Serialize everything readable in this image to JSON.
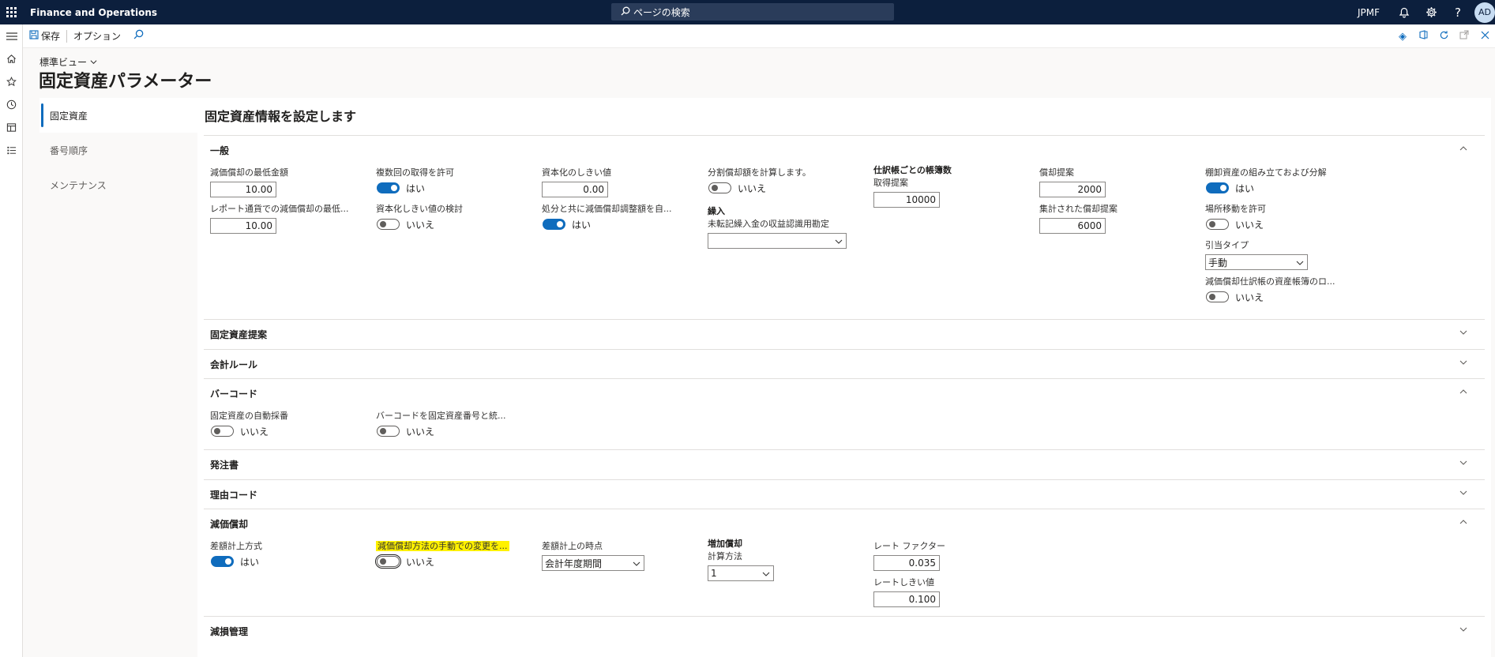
{
  "topbar": {
    "app_title": "Finance and Operations",
    "search_placeholder": "ページの検索",
    "company": "JPMF",
    "avatar_initials": "AD",
    "icons": [
      "waffle-icon",
      "bell-icon",
      "gear-icon",
      "help-icon"
    ]
  },
  "actionpane": {
    "save_label": "保存",
    "options_label": "オプション"
  },
  "header": {
    "view_selector": "標準ビュー",
    "page_title": "固定資産パラメーター"
  },
  "vtabs": [
    "固定資産",
    "番号順序",
    "メンテナンス"
  ],
  "content": {
    "title": "固定資産情報を設定します"
  },
  "general": {
    "title": "一般",
    "min_dep_amount_label": "減価償却の最低金額",
    "min_dep_amount_value": "10.00",
    "report_currency_min_label": "レポート通貨での減価償却の最低...",
    "report_currency_min_value": "10.00",
    "allow_multiple_acq_label": "複数回の取得を許可",
    "allow_multiple_acq_text": "はい",
    "cap_threshold_review_label": "資本化しきい値の検討",
    "cap_threshold_review_text": "いいえ",
    "cap_threshold_label": "資本化のしきい値",
    "cap_threshold_value": "0.00",
    "disposal_dep_adj_label": "処分と共に減価償却調整額を自...",
    "disposal_dep_adj_text": "はい",
    "calc_partial_dep_label": "分割償却額を計算します。",
    "calc_partial_dep_text": "いいえ",
    "carry_in_head": "繰入",
    "unposted_carry_in_label": "未転記繰入金の収益認識用勘定",
    "unposted_carry_in_value": "",
    "books_per_journal_head": "仕訳帳ごとの帳簿数",
    "acq_proposal_label": "取得提案",
    "acq_proposal_value": "10000",
    "dep_proposal_label": "償却提案",
    "dep_proposal_value": "2000",
    "summarized_dep_proposal_label": "集計された償却提案",
    "summarized_dep_proposal_value": "6000",
    "inventory_assembly_label": "棚卸資産の組み立ておよび分解",
    "inventory_assembly_text": "はい",
    "allow_transfer_label": "場所移動を許可",
    "allow_transfer_text": "いいえ",
    "reservation_type_label": "引当タイプ",
    "reservation_type_value": "手動",
    "dep_journal_lock_label": "減価償却仕訳帳の資産帳簿のロ...",
    "dep_journal_lock_text": "いいえ"
  },
  "fasttabs": {
    "fixed_asset_proposal": "固定資産提案",
    "accounting_rules": "会計ルール",
    "barcode": "バーコード",
    "purchase_orders": "発注書",
    "reason_codes": "理由コード",
    "depreciation": "減価償却",
    "impairment": "減損管理"
  },
  "barcode": {
    "auto_number_label": "固定資産の自動採番",
    "auto_number_text": "いいえ",
    "unify_barcode_label": "バーコードを固定資産番号と統...",
    "unify_barcode_text": "いいえ"
  },
  "depreciation": {
    "diff_method_label": "差額計上方式",
    "diff_method_text": "はい",
    "manual_change_label": "減価償却方法の手動での変更を...",
    "manual_change_text": "いいえ",
    "diff_timing_label": "差額計上の時点",
    "diff_timing_value": "会計年度期間",
    "increase_head": "増加償却",
    "calc_method_label": "計算方法",
    "calc_method_value": "1",
    "rate_factor_label": "レート ファクター",
    "rate_factor_value": "0.035",
    "rate_threshold_label": "レートしきい値",
    "rate_threshold_value": "0.100"
  },
  "colors": {
    "accent": "#0f6cbd",
    "topbar": "#0c1f3d",
    "highlight": "#fff100"
  }
}
